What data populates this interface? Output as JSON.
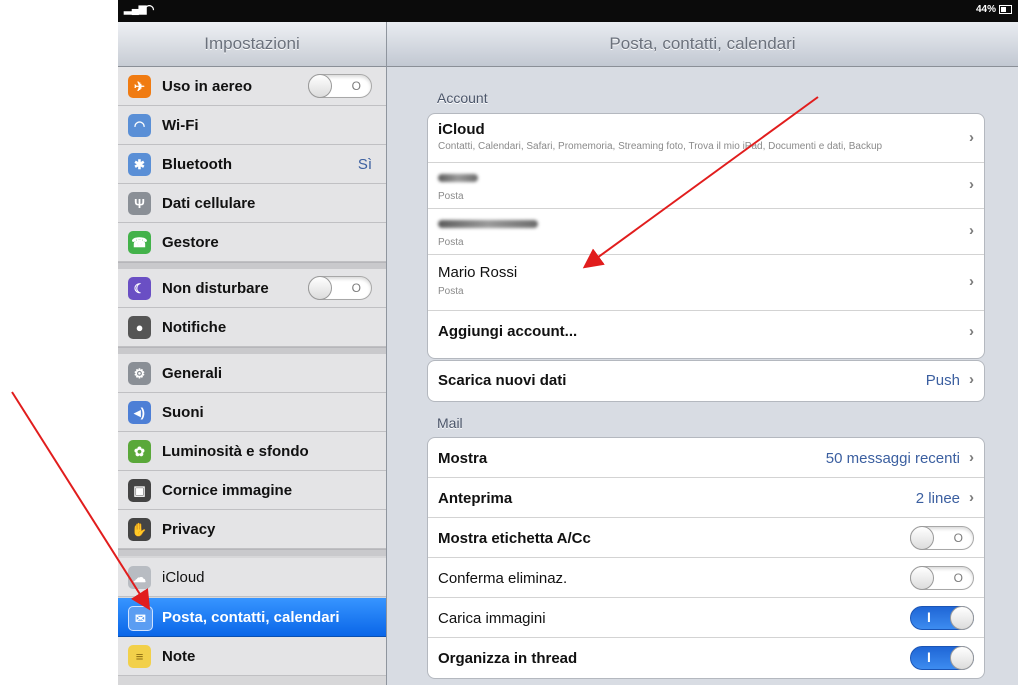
{
  "status_bar": {
    "battery": "44%"
  },
  "sidebar": {
    "title": "Impostazioni",
    "items": [
      {
        "label": "Uso in aereo",
        "icon": "airplane-icon",
        "color": "#f07b12"
      },
      {
        "label": "Wi-Fi",
        "icon": "wifi-icon",
        "color": "#5a8fd6"
      },
      {
        "label": "Bluetooth",
        "icon": "bluetooth-icon",
        "color": "#5a8fd6",
        "value": "Sì"
      },
      {
        "label": "Dati cellulare",
        "icon": "cellular-antenna-icon",
        "color": "#8a8f96"
      },
      {
        "label": "Gestore",
        "icon": "phone-icon",
        "color": "#43b24a"
      },
      {
        "label": "Non disturbare",
        "icon": "moon-icon",
        "color": "#6a4fc4"
      },
      {
        "label": "Notifiche",
        "icon": "notifications-icon",
        "color": "#d33"
      },
      {
        "label": "Generali",
        "icon": "gear-icon",
        "color": "#8a8f96"
      },
      {
        "label": "Suoni",
        "icon": "speaker-icon",
        "color": "#4d7fd6"
      },
      {
        "label": "Luminosità e sfondo",
        "icon": "flower-icon",
        "color": "#5aa83a"
      },
      {
        "label": "Cornice immagine",
        "icon": "picture-frame-icon",
        "color": "#444"
      },
      {
        "label": "Privacy",
        "icon": "hand-icon",
        "color": "#444"
      },
      {
        "label": "iCloud",
        "icon": "cloud-icon",
        "color": "#b8bcc2"
      },
      {
        "label": "Posta, contatti, calendari",
        "icon": "mail-icon",
        "color": "#2e7be0"
      },
      {
        "label": "Note",
        "icon": "notes-icon",
        "color": "#f2d04a"
      }
    ]
  },
  "detail": {
    "title": "Posta, contatti, calendari",
    "account_header": "Account",
    "accounts": [
      {
        "title": "iCloud",
        "subtitle": "Contatti, Calendari, Safari, Promemoria, Streaming foto, Trova il mio iPad, Documenti e dati, Backup"
      },
      {
        "title": "",
        "subtitle": "Posta"
      },
      {
        "title": "",
        "subtitle": "Posta"
      },
      {
        "title": "Mario Rossi",
        "subtitle": "Posta"
      },
      {
        "title": "Aggiungi account...",
        "subtitle": ""
      }
    ],
    "fetch": {
      "label": "Scarica nuovi dati",
      "value": "Push"
    },
    "mail_header": "Mail",
    "mail": [
      {
        "label": "Mostra",
        "value": "50 messaggi recenti"
      },
      {
        "label": "Anteprima",
        "value": "2 linee"
      },
      {
        "label": "Mostra etichetta A/Cc",
        "toggle": "off"
      },
      {
        "label": "Conferma eliminaz.",
        "toggle": "off"
      },
      {
        "label": "Carica immagini",
        "toggle": "on"
      },
      {
        "label": "Organizza in thread",
        "toggle": "on"
      }
    ]
  },
  "toggles": {
    "airplane": "off",
    "dnd": "off"
  },
  "accent_color": "#e11d1d"
}
